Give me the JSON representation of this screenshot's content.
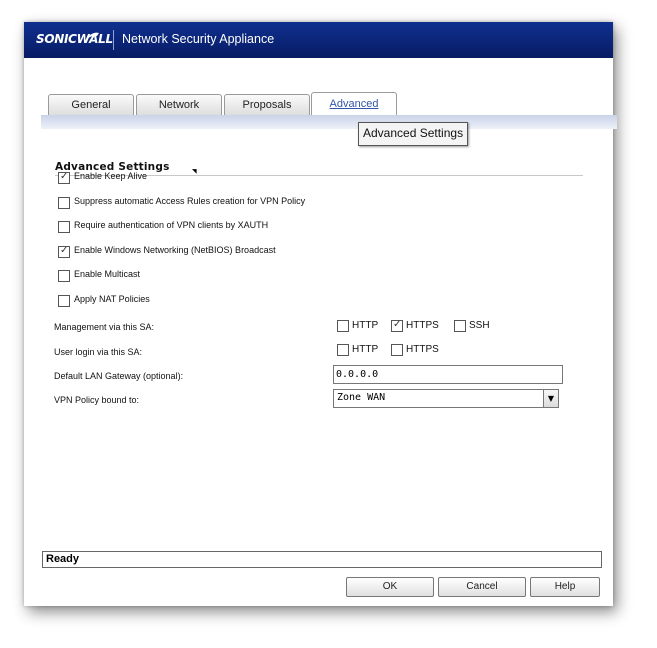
{
  "window": {
    "logo": "SONICWALL",
    "title": "Network Security Appliance"
  },
  "tabs": [
    {
      "label": "General",
      "active": false
    },
    {
      "label": "Network",
      "active": false
    },
    {
      "label": "Proposals",
      "active": false
    },
    {
      "label": "Advanced",
      "active": true
    }
  ],
  "tooltip": "Advanced Settings",
  "section": {
    "title": "Advanced Settings"
  },
  "options": [
    {
      "label": "Enable Keep Alive",
      "checked": true
    },
    {
      "label": "Suppress automatic Access Rules creation for VPN Policy",
      "checked": false
    },
    {
      "label": "Require authentication of VPN clients by XAUTH",
      "checked": false
    },
    {
      "label": "Enable Windows Networking (NetBIOS) Broadcast",
      "checked": true
    },
    {
      "label": "Enable Multicast",
      "checked": false
    },
    {
      "label": "Apply NAT Policies",
      "checked": false
    }
  ],
  "management": {
    "label": "Management via this SA:",
    "options": [
      {
        "label": "HTTP",
        "checked": false
      },
      {
        "label": "HTTPS",
        "checked": true
      },
      {
        "label": "SSH",
        "checked": false
      }
    ]
  },
  "user_login": {
    "label": "User login via this SA:",
    "options": [
      {
        "label": "HTTP",
        "checked": false
      },
      {
        "label": "HTTPS",
        "checked": false
      }
    ]
  },
  "gateway": {
    "label": "Default LAN Gateway (optional):",
    "value": "0.0.0.0"
  },
  "vpn_policy": {
    "label": "VPN Policy bound to:",
    "selected": "Zone WAN"
  },
  "status": "Ready",
  "buttons": {
    "ok": "OK",
    "cancel": "Cancel",
    "help": "Help"
  },
  "icons": {
    "check": "✓",
    "dropdown": "▼",
    "caret": "◥"
  }
}
